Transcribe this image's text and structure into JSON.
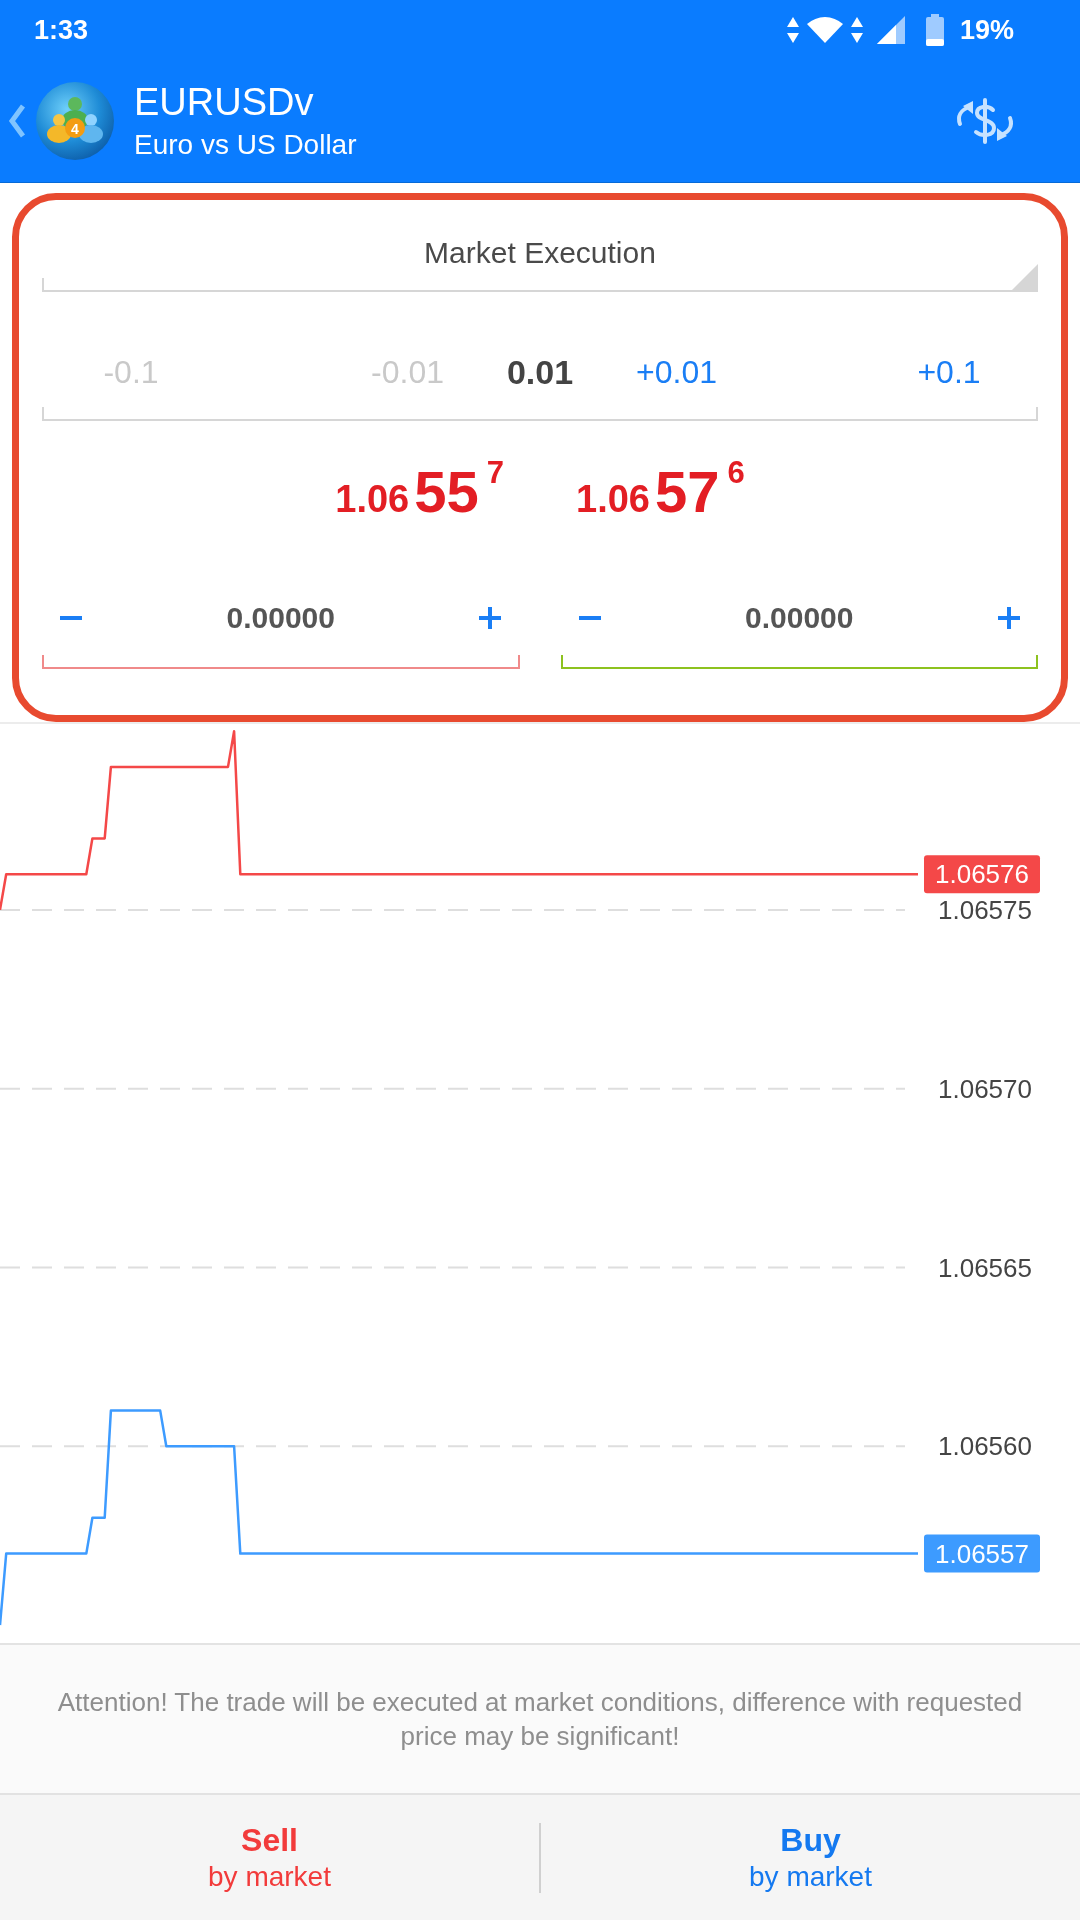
{
  "status_bar": {
    "time": "1:33",
    "battery": "19%"
  },
  "header": {
    "logo_mark": "4",
    "symbol": "EURUSDv",
    "description": "Euro vs US Dollar"
  },
  "order": {
    "execution": "Market Execution",
    "volume": {
      "decrease": [
        {
          "label": "-0.1",
          "disabled": true
        },
        {
          "label": "-0.01",
          "disabled": true
        }
      ],
      "value": "0.01",
      "increase": [
        {
          "label": "+0.01",
          "disabled": false
        },
        {
          "label": "+0.1",
          "disabled": false
        }
      ]
    },
    "quotes": [
      {
        "head": "1.06",
        "pips": "55",
        "tail": "7",
        "down": true
      },
      {
        "head": "1.06",
        "pips": "57",
        "tail": "6",
        "down": true
      }
    ],
    "level_fields": [
      {
        "value": "0.00000",
        "color": "#f08a8a"
      },
      {
        "value": "0.00000",
        "color": "#8dc21f"
      }
    ]
  },
  "chart": {
    "chart_data": {
      "type": "line",
      "grid": true,
      "categories": [
        null,
        null,
        null,
        null,
        null,
        null,
        null,
        null,
        null,
        null,
        null,
        null,
        null,
        null,
        null,
        null,
        null,
        null,
        null,
        null,
        null,
        null,
        null,
        null,
        null,
        null,
        null,
        null,
        null,
        null,
        null,
        null,
        null,
        null,
        null,
        null,
        null,
        null,
        null,
        null,
        null,
        null,
        null,
        null,
        null,
        null,
        null,
        null,
        null,
        null,
        null,
        null,
        null,
        null,
        null,
        null,
        null,
        null,
        null,
        null,
        null,
        null,
        null,
        null,
        null,
        null,
        null,
        null,
        null,
        null,
        null,
        null,
        null,
        null,
        null,
        null,
        null,
        null,
        null,
        null,
        null,
        null,
        null,
        null,
        null,
        null,
        null,
        null,
        null,
        null,
        null,
        null,
        null,
        null,
        null,
        null,
        null,
        null,
        null,
        null,
        null,
        null,
        null,
        null,
        null,
        null,
        null,
        null,
        null,
        null,
        null,
        null,
        null,
        null,
        null,
        null,
        null,
        null,
        null,
        null,
        null,
        null,
        null,
        null,
        null,
        null,
        null,
        null,
        null,
        null,
        null,
        null,
        null,
        null,
        null,
        null,
        null,
        null,
        null,
        null,
        null,
        null,
        null,
        null,
        null,
        null,
        null,
        null,
        null,
        null
      ],
      "series": [
        {
          "color": "#f44848",
          "values": [
            1.06575,
            1.06576,
            1.06576,
            1.06576,
            1.06576,
            1.06576,
            1.06576,
            1.06576,
            1.06576,
            1.06576,
            1.06576,
            1.06576,
            1.06576,
            1.06576,
            1.06576,
            1.06577,
            1.06577,
            1.06577,
            1.06579,
            1.06579,
            1.06579,
            1.06579,
            1.06579,
            1.06579,
            1.06579,
            1.06579,
            1.06579,
            1.06579,
            1.06579,
            1.06579,
            1.06579,
            1.06579,
            1.06579,
            1.06579,
            1.06579,
            1.06579,
            1.06579,
            1.06579,
            1.0658,
            1.06576,
            1.06576,
            1.06576,
            1.06576,
            1.06576,
            1.06576,
            1.06576,
            1.06576,
            1.06576,
            1.06576,
            1.06576,
            1.06576,
            1.06576,
            1.06576,
            1.06576,
            1.06576,
            1.06576,
            1.06576,
            1.06576,
            1.06576,
            1.06576,
            1.06576,
            1.06576,
            1.06576,
            1.06576,
            1.06576,
            1.06576,
            1.06576,
            1.06576,
            1.06576,
            1.06576,
            1.06576,
            1.06576,
            1.06576,
            1.06576,
            1.06576,
            1.06576,
            1.06576,
            1.06576,
            1.06576,
            1.06576,
            1.06576,
            1.06576,
            1.06576,
            1.06576,
            1.06576,
            1.06576,
            1.06576,
            1.06576,
            1.06576,
            1.06576,
            1.06576,
            1.06576,
            1.06576,
            1.06576,
            1.06576,
            1.06576,
            1.06576,
            1.06576,
            1.06576,
            1.06576,
            1.06576,
            1.06576,
            1.06576,
            1.06576,
            1.06576,
            1.06576,
            1.06576,
            1.06576,
            1.06576,
            1.06576,
            1.06576,
            1.06576,
            1.06576,
            1.06576,
            1.06576,
            1.06576,
            1.06576,
            1.06576,
            1.06576,
            1.06576,
            1.06576,
            1.06576,
            1.06576,
            1.06576,
            1.06576,
            1.06576,
            1.06576,
            1.06576,
            1.06576,
            1.06576,
            1.06576,
            1.06576,
            1.06576,
            1.06576,
            1.06576,
            1.06576,
            1.06576,
            1.06576,
            1.06576,
            1.06576,
            1.06576,
            1.06576,
            1.06576,
            1.06576,
            1.06576,
            1.06576,
            1.06576,
            1.06576,
            1.06576,
            1.06576
          ]
        },
        {
          "color": "#3d9bff",
          "values": [
            1.06555,
            1.06557,
            1.06557,
            1.06557,
            1.06557,
            1.06557,
            1.06557,
            1.06557,
            1.06557,
            1.06557,
            1.06557,
            1.06557,
            1.06557,
            1.06557,
            1.06557,
            1.06558,
            1.06558,
            1.06558,
            1.06561,
            1.06561,
            1.06561,
            1.06561,
            1.06561,
            1.06561,
            1.06561,
            1.06561,
            1.06561,
            1.0656,
            1.0656,
            1.0656,
            1.0656,
            1.0656,
            1.0656,
            1.0656,
            1.0656,
            1.0656,
            1.0656,
            1.0656,
            1.0656,
            1.06557,
            1.06557,
            1.06557,
            1.06557,
            1.06557,
            1.06557,
            1.06557,
            1.06557,
            1.06557,
            1.06557,
            1.06557,
            1.06557,
            1.06557,
            1.06557,
            1.06557,
            1.06557,
            1.06557,
            1.06557,
            1.06557,
            1.06557,
            1.06557,
            1.06557,
            1.06557,
            1.06557,
            1.06557,
            1.06557,
            1.06557,
            1.06557,
            1.06557,
            1.06557,
            1.06557,
            1.06557,
            1.06557,
            1.06557,
            1.06557,
            1.06557,
            1.06557,
            1.06557,
            1.06557,
            1.06557,
            1.06557,
            1.06557,
            1.06557,
            1.06557,
            1.06557,
            1.06557,
            1.06557,
            1.06557,
            1.06557,
            1.06557,
            1.06557,
            1.06557,
            1.06557,
            1.06557,
            1.06557,
            1.06557,
            1.06557,
            1.06557,
            1.06557,
            1.06557,
            1.06557,
            1.06557,
            1.06557,
            1.06557,
            1.06557,
            1.06557,
            1.06557,
            1.06557,
            1.06557,
            1.06557,
            1.06557,
            1.06557,
            1.06557,
            1.06557,
            1.06557,
            1.06557,
            1.06557,
            1.06557,
            1.06557,
            1.06557,
            1.06557,
            1.06557,
            1.06557,
            1.06557,
            1.06557,
            1.06557,
            1.06557,
            1.06557,
            1.06557,
            1.06557,
            1.06557,
            1.06557,
            1.06557,
            1.06557,
            1.06557,
            1.06557,
            1.06557,
            1.06557,
            1.06557,
            1.06557,
            1.06557,
            1.06557,
            1.06557,
            1.06557,
            1.06557,
            1.06557,
            1.06557,
            1.06557,
            1.06557,
            1.06557,
            1.06557
          ]
        }
      ],
      "ylim": [
        1.065545,
        1.065802
      ],
      "yticks": [
        {
          "value": 1.06575,
          "label": "1.06575"
        },
        {
          "value": 1.0657,
          "label": "1.06570"
        },
        {
          "value": 1.06565,
          "label": "1.06565"
        },
        {
          "value": 1.0656,
          "label": "1.06560"
        }
      ],
      "annotations": [
        {
          "text": "1.06576"
        },
        {
          "text": "1.06557"
        }
      ]
    }
  },
  "notice": "Attention! The trade will be executed at market conditions, difference with requested price may be significant!",
  "actions": [
    {
      "kind": "sell",
      "title": "Sell",
      "subtitle": "by market"
    },
    {
      "kind": "buy",
      "title": "Buy",
      "subtitle": "by market"
    }
  ]
}
